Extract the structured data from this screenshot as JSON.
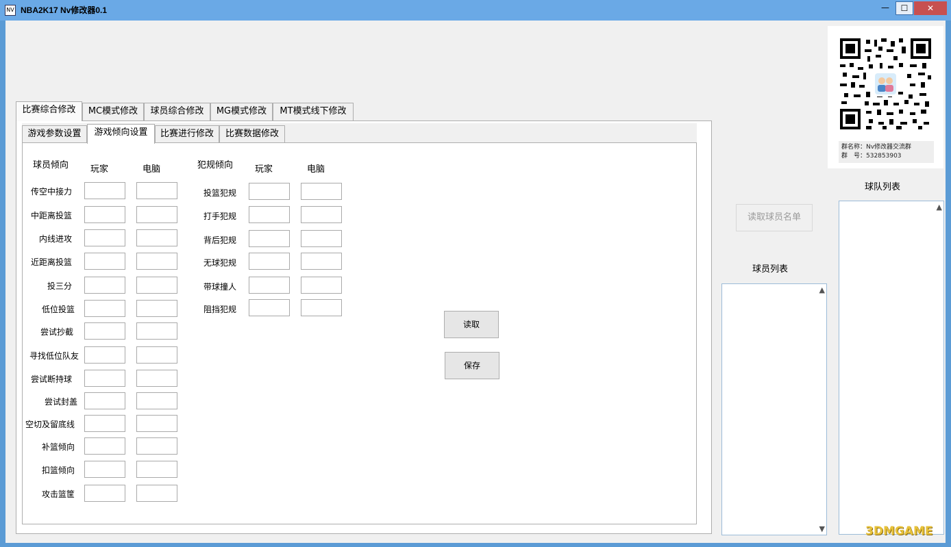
{
  "window": {
    "title": "NBA2K17 Nv修改器0.1",
    "icon_label": "NV",
    "minimize_label": "—",
    "maximize_label": "☐",
    "close_label": "✕"
  },
  "qr": {
    "group_name": "群名称：Nv修改器交流群",
    "group_number": "群　号：532853903"
  },
  "outer_tabs": [
    {
      "label": "比赛综合修改",
      "active": true
    },
    {
      "label": "MC模式修改",
      "active": false
    },
    {
      "label": "球员综合修改",
      "active": false
    },
    {
      "label": "MG模式修改",
      "active": false
    },
    {
      "label": "MT模式线下修改",
      "active": false
    }
  ],
  "inner_tabs": [
    {
      "label": "游戏参数设置",
      "active": false
    },
    {
      "label": "游戏倾向设置",
      "active": true
    },
    {
      "label": "比赛进行修改",
      "active": false
    },
    {
      "label": "比赛数据修改",
      "active": false
    }
  ],
  "tendency": {
    "header": "球员倾向",
    "player_col": "玩家",
    "cpu_col": "电脑",
    "rows": [
      "传空中接力",
      "中距离投篮",
      "内线进攻",
      "近距离投篮",
      "投三分",
      "低位投篮",
      "尝试抄截",
      "寻找低位队友",
      "尝试断持球",
      "尝试封盖",
      "空切及留底线",
      "补篮倾向",
      "扣篮倾向",
      "攻击篮筐"
    ]
  },
  "foul": {
    "header": "犯规倾向",
    "player_col": "玩家",
    "cpu_col": "电脑",
    "rows": [
      "投篮犯规",
      "打手犯规",
      "背后犯规",
      "无球犯规",
      "带球撞人",
      "阻挡犯规"
    ]
  },
  "buttons": {
    "read": "读取",
    "save": "保存",
    "read_players": "读取球员名单"
  },
  "lists": {
    "team_title": "球队列表",
    "player_title": "球员列表",
    "scroll_up": "▲",
    "scroll_down": "▼"
  },
  "watermark": "3DMGAME"
}
